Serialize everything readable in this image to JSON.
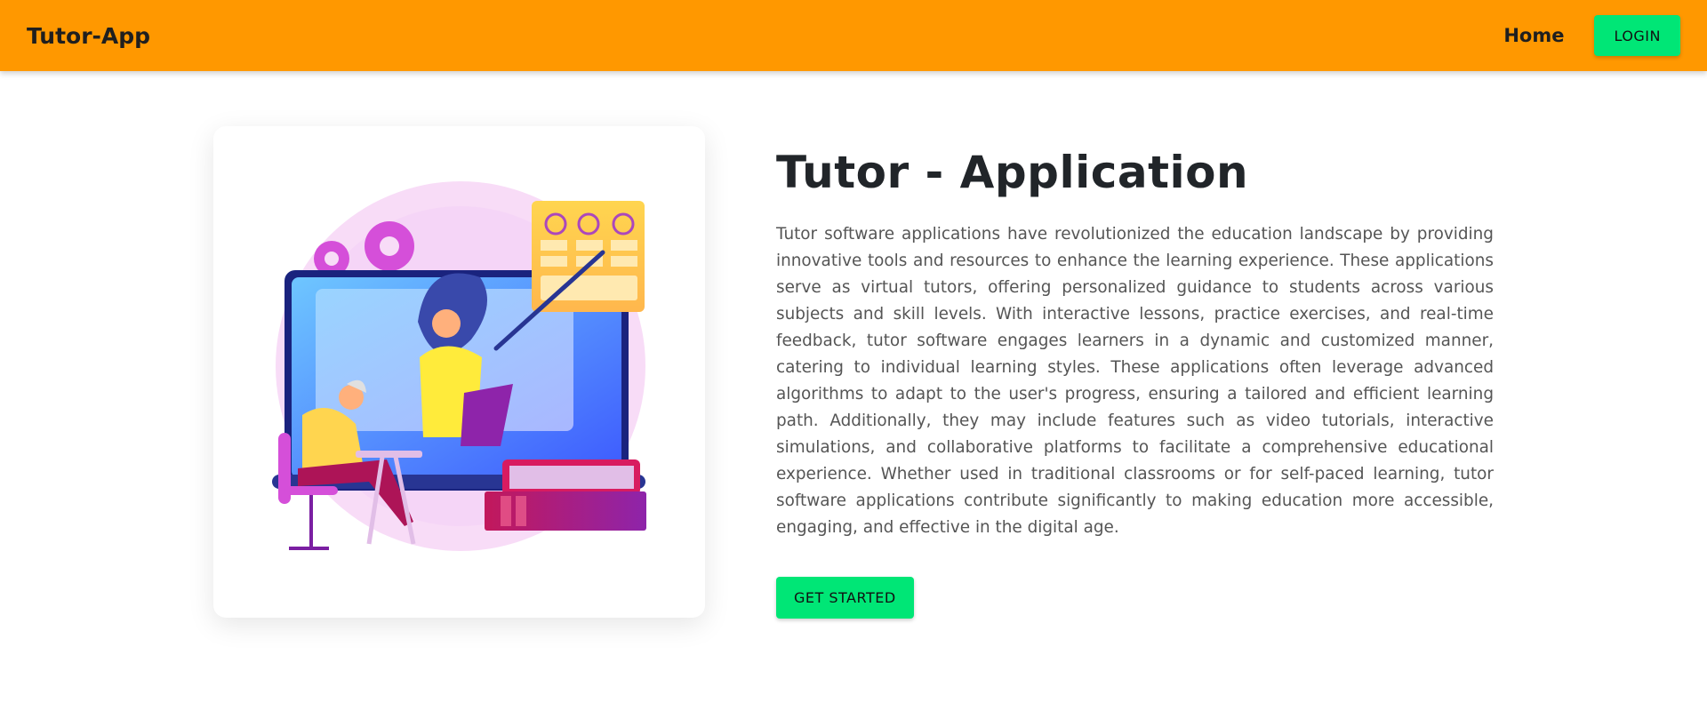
{
  "navbar": {
    "brand": "Tutor-App",
    "links": [
      {
        "label": "Home"
      }
    ],
    "login_label": "LOGIN"
  },
  "hero": {
    "title": "Tutor - Application",
    "description": "Tutor software applications have revolutionized the education landscape by providing innovative tools and resources to enhance the learning experience. These applications serve as virtual tutors, offering personalized guidance to students across various subjects and skill levels. With interactive lessons, practice exercises, and real-time feedback, tutor software engages learners in a dynamic and customized manner, catering to individual learning styles. These applications often leverage advanced algorithms to adapt to the user's progress, ensuring a tailored and efficient learning path. Additionally, they may include features such as video tutorials, interactive simulations, and collaborative platforms to facilitate a comprehensive educational experience. Whether used in traditional classrooms or for self-paced learning, tutor software applications contribute significantly to making education more accessible, engaging, and effective in the digital age.",
    "cta_label": "GET STARTED"
  },
  "colors": {
    "navbar_bg": "#ff9800",
    "button_green": "#00e676",
    "title_text": "#212529",
    "body_text": "#555555"
  },
  "icons": {
    "illustration": "online-tutor-illustration"
  }
}
